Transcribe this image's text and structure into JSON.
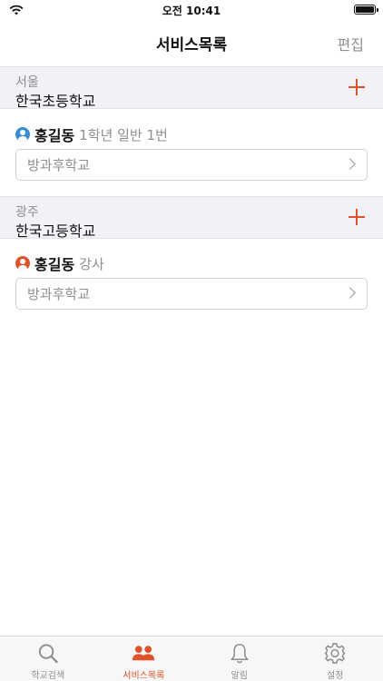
{
  "status": {
    "time": "오전 10:41"
  },
  "nav": {
    "title": "서비스목록",
    "edit_label": "편집"
  },
  "sections": [
    {
      "region": "서울",
      "school": "한국초등학교",
      "member": {
        "name": "홍길동",
        "role": "1학년 일반 1번",
        "avatar_color": "#3b8ed6"
      },
      "service": "방과후학교"
    },
    {
      "region": "광주",
      "school": "한국고등학교",
      "member": {
        "name": "홍길동",
        "role": "강사",
        "avatar_color": "#e0522b"
      },
      "service": "방과후학교"
    }
  ],
  "tabs": [
    {
      "label": "학교검색",
      "icon": "search-icon",
      "active": false
    },
    {
      "label": "서비스목록",
      "icon": "people-icon",
      "active": true
    },
    {
      "label": "알림",
      "icon": "bell-icon",
      "active": false
    },
    {
      "label": "설정",
      "icon": "gear-icon",
      "active": false
    }
  ],
  "colors": {
    "accent": "#e0522b",
    "muted": "#8e8e93",
    "section_bg": "#f2f1f6"
  }
}
